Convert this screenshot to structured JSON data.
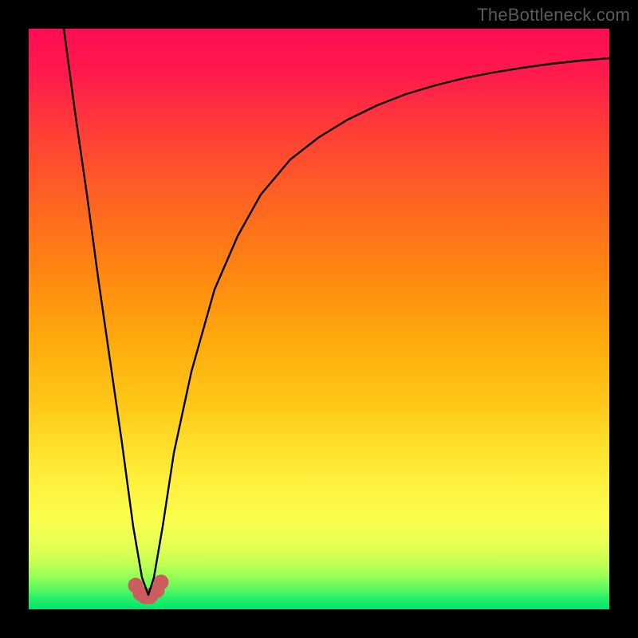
{
  "watermark": "TheBottleneck.com",
  "chart_data": {
    "type": "line",
    "title": "",
    "xlabel": "",
    "ylabel": "",
    "xlim": [
      0,
      100
    ],
    "ylim": [
      0,
      100
    ],
    "grid": false,
    "background_top_color": "#ff0c53",
    "background_bottom_color": "#00e56d",
    "series": [
      {
        "name": "bottleneck-curve",
        "x": [
          6,
          8,
          10,
          12,
          14,
          16,
          18,
          19.5,
          20.5,
          21.5,
          23,
          25,
          28,
          32,
          36,
          40,
          45,
          50,
          55,
          60,
          65,
          70,
          75,
          80,
          85,
          90,
          95,
          100
        ],
        "y": [
          100,
          86,
          72,
          58,
          44,
          30,
          16,
          6,
          3,
          6,
          16,
          28,
          42,
          56,
          65,
          71,
          77,
          81,
          84,
          86.5,
          88.5,
          90,
          91.2,
          92.2,
          93,
          93.7,
          94.3,
          94.8
        ],
        "color": "#000000"
      },
      {
        "name": "marker-fill",
        "x": [
          18.5,
          19.2,
          20,
          20.7,
          21,
          22,
          22.7
        ],
        "y": [
          4.5,
          2.8,
          2.3,
          2.3,
          2.5,
          3.5,
          5
        ],
        "color": "#cd5c5c"
      }
    ],
    "green_band_y": [
      0,
      6
    ]
  }
}
